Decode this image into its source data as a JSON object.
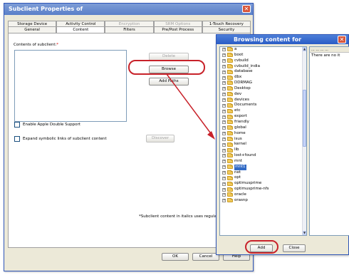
{
  "dialog": {
    "title": "Subclient Properties of",
    "tabs_row1": [
      "Storage Device",
      "Activity Control",
      "Encryption",
      "SRM Options",
      "1-Touch Recovery"
    ],
    "tabs_row2": [
      "General",
      "Content",
      "Filters",
      "Pre/Post Process",
      "Security"
    ],
    "contents_label": "Contents of subclient:",
    "required_mark": "*",
    "delete_label": "Delete",
    "browse_label": "Browse",
    "add_paths_label": "Add Paths",
    "apple_double_label": "Enable Apple Double Support",
    "symbolic_links_label": "Expand symbolic links of subclient content",
    "discover_label": "Discover",
    "italics_note": "*Subclient content in italics uses regular",
    "ok_label": "OK",
    "cancel_label": "Cancel",
    "help_label": "Help"
  },
  "browse": {
    "title": "Browsing content for",
    "right_header": "...  ...  ...  ...",
    "empty_message": "There are no it",
    "add_label": "Add",
    "close_label": "Close",
    "tree": [
      "a",
      "boot",
      "cvbuild",
      "cvbuild_india",
      "database",
      "dbx",
      "DDRMAG",
      "Desktop",
      "dev",
      "devices",
      "Documents",
      "etc",
      "export",
      "friendly",
      "global",
      "home",
      "isus",
      "kernel",
      "lib",
      "lost+found",
      "mnt",
      "mnt1",
      "net",
      "opt",
      "optimusprime",
      "optimusprime-nfs",
      "oracle",
      "orasnp"
    ],
    "selected": "mnt1"
  },
  "colors": {
    "highlight_oval": "#c8222a",
    "selection": "#316ac5",
    "title_bar": "#5a7fc9"
  }
}
